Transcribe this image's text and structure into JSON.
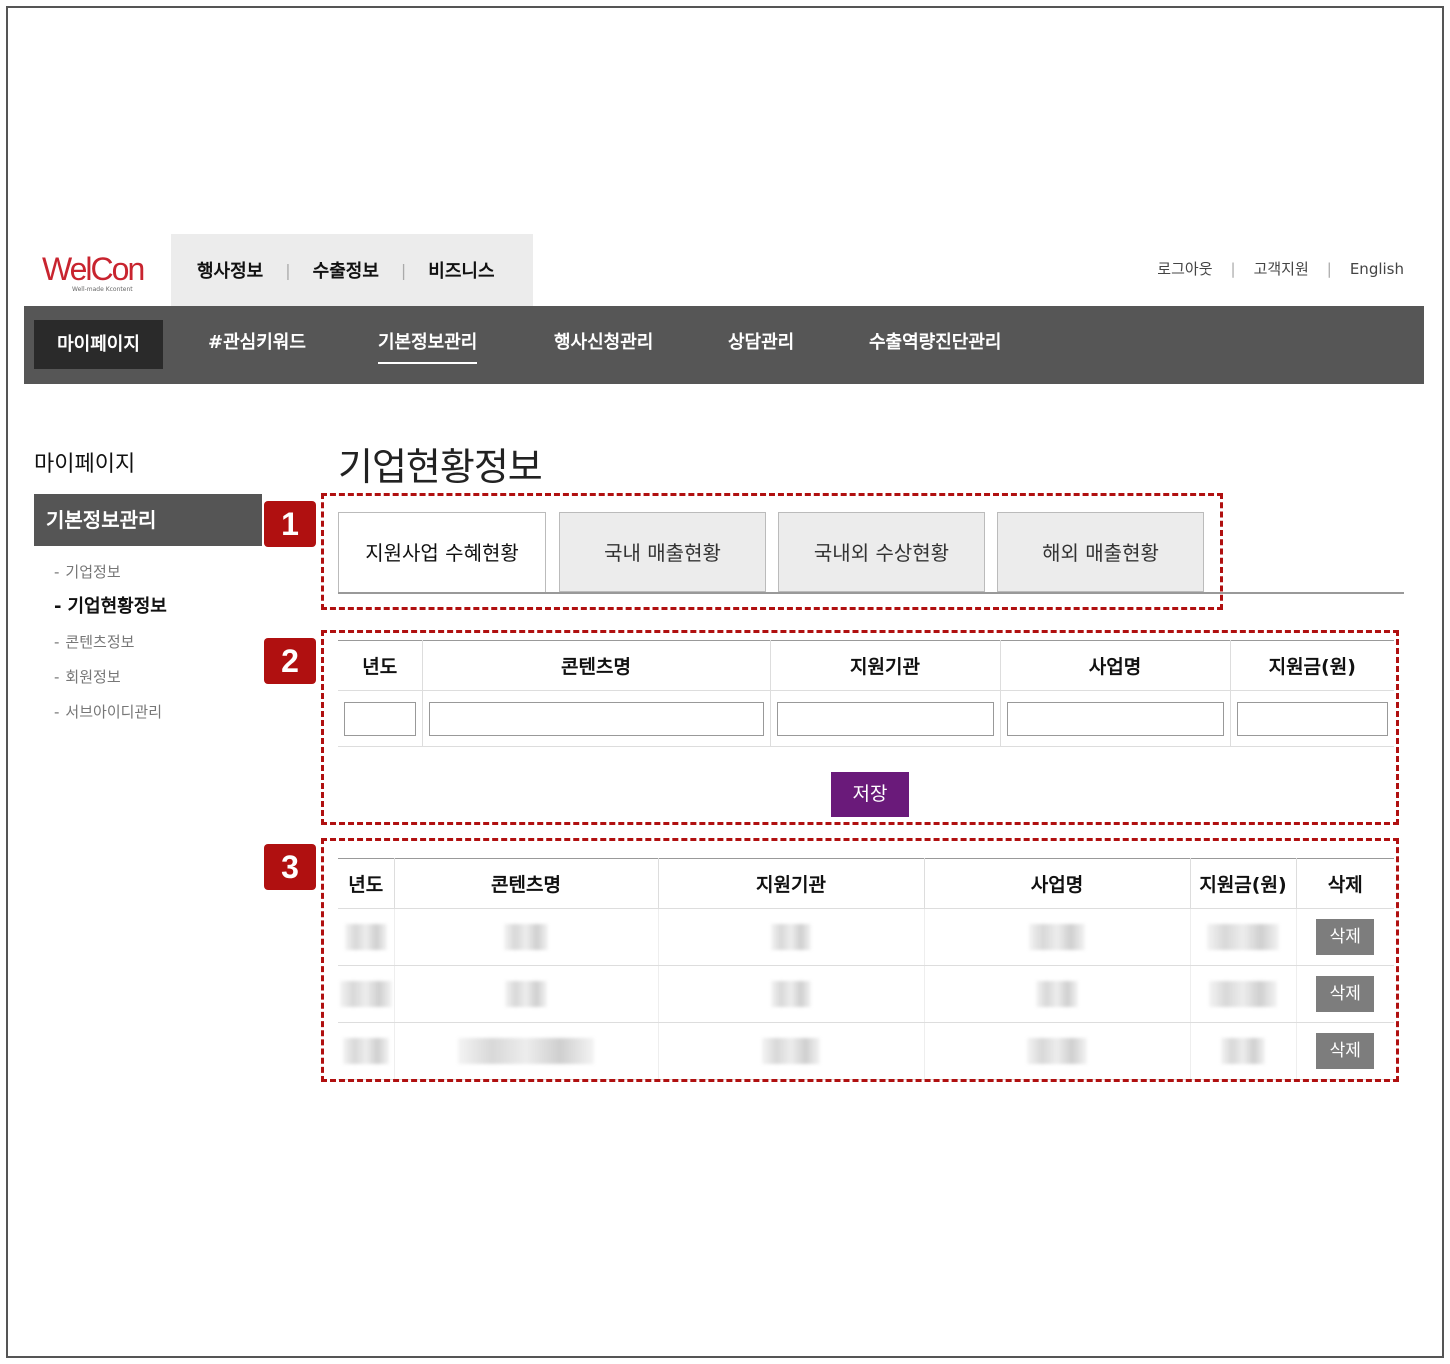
{
  "logo": {
    "name": "WelCon",
    "tagline": "Well-made Kcontent"
  },
  "top_nav": [
    "행사정보",
    "수출정보",
    "비즈니스"
  ],
  "utility": [
    "로그아웃",
    "고객지원",
    "English"
  ],
  "main_nav": {
    "home": "마이페이지",
    "items": [
      "#관심키워드",
      "기본정보관리",
      "행사신청관리",
      "상담관리",
      "수출역량진단관리"
    ],
    "active": "기본정보관리"
  },
  "sidebar": {
    "title": "마이페이지",
    "section": "기본정보관리",
    "items": [
      "기업정보",
      "기업현황정보",
      "콘텐츠정보",
      "회원정보",
      "서브아이디관리"
    ],
    "active": "기업현황정보"
  },
  "page_title": "기업현황정보",
  "tabs": [
    "지원사업 수혜현황",
    "국내 매출현황",
    "국내외 수상현황",
    "해외 매출현황"
  ],
  "active_tab": "지원사업 수혜현황",
  "form": {
    "headers": [
      "년도",
      "콘텐츠명",
      "지원기관",
      "사업명",
      "지원금(원)"
    ],
    "save_label": "저장"
  },
  "list": {
    "headers": [
      "년도",
      "콘텐츠명",
      "지원기관",
      "사업명",
      "지원금(원)",
      "삭제"
    ],
    "delete_label": "삭제",
    "row_count": 3
  },
  "annotations": [
    "1",
    "2",
    "3"
  ],
  "colors": {
    "annotation": "#b01010",
    "save_button": "#6a1a7a",
    "nav_bg": "#565656",
    "logo": "#c8242f"
  }
}
